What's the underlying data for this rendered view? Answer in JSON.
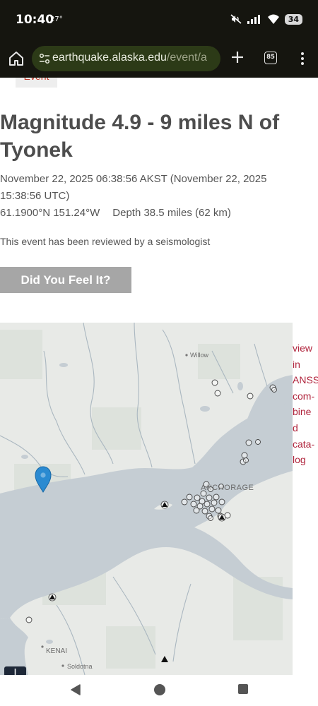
{
  "status_bar": {
    "time": "10:40",
    "temperature": "27°",
    "battery": "34",
    "icons": [
      "mute-icon",
      "signal-icon",
      "wifi-icon",
      "battery-icon"
    ]
  },
  "browser": {
    "url_domain": "earthquake.alaska.edu",
    "url_path": "/event/a",
    "tab_count": "85",
    "icons": [
      "home-icon",
      "site-settings-icon",
      "new-tab-plus-icon",
      "tab-switcher-icon",
      "overflow-menu-icon"
    ]
  },
  "page": {
    "tab_label": "Event",
    "title": "Magnitude 4.9 - 9 miles N of Tyonek",
    "datetime": "November 22, 2025 06:38:56 AKST (November 22, 2025 15:38:56 UTC)",
    "coordinates": "61.1900°N 151.24°W",
    "depth": "Depth 38.5 miles (62 km)",
    "reviewed_text": "This event has been reviewed by a seismologist",
    "dyfi_button": "Did You Feel It?",
    "side_link_lines": [
      "view",
      "in",
      "ANSS",
      "com-",
      "bine",
      "d",
      "cata-",
      "log"
    ]
  },
  "map": {
    "labels": {
      "willow": "Willow",
      "anchorage": "ANCHORAGE",
      "kenai": "KENAI",
      "soldotna": "Soldotna"
    },
    "colors": {
      "land": "#e8eae7",
      "water": "#c5cdd3",
      "marker": "#2a8ad1"
    }
  },
  "nav_bar": {
    "icons": [
      "back-triangle-icon",
      "home-circle-icon",
      "recents-square-icon"
    ]
  }
}
